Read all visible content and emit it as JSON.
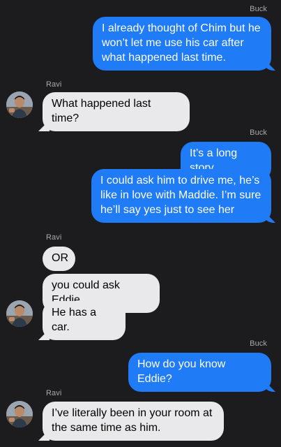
{
  "messages": [
    {
      "sender": "Buck",
      "text": "I already thought of Chim but he won’t let me use his car after what happened last time."
    },
    {
      "sender": "Ravi",
      "text": "What happened last time?"
    },
    {
      "sender": "Buck",
      "text": "It’s a long story"
    },
    {
      "sender": "Buck",
      "text": "I could ask him to drive me, he’s like in love with Maddie. I’m sure he’ll say yes just to see her"
    },
    {
      "sender": "Ravi",
      "text": "OR"
    },
    {
      "sender": "Ravi",
      "text": "you could ask Eddie"
    },
    {
      "sender": "Ravi",
      "text": "He has a car."
    },
    {
      "sender": "Buck",
      "text": "How do you know Eddie?"
    },
    {
      "sender": "Ravi",
      "text": "I’ve literally been in your room at the same time as him."
    }
  ],
  "labels": {
    "buck": "Buck",
    "ravi": "Ravi"
  },
  "colors": {
    "background": "#1c1c1e",
    "outgoing_bubble": "#1f7bf6",
    "incoming_bubble": "#e9e9eb",
    "sender_label": "#a9a9ad"
  },
  "icons": {
    "ravi_avatar": "contact-photo-avatar"
  }
}
